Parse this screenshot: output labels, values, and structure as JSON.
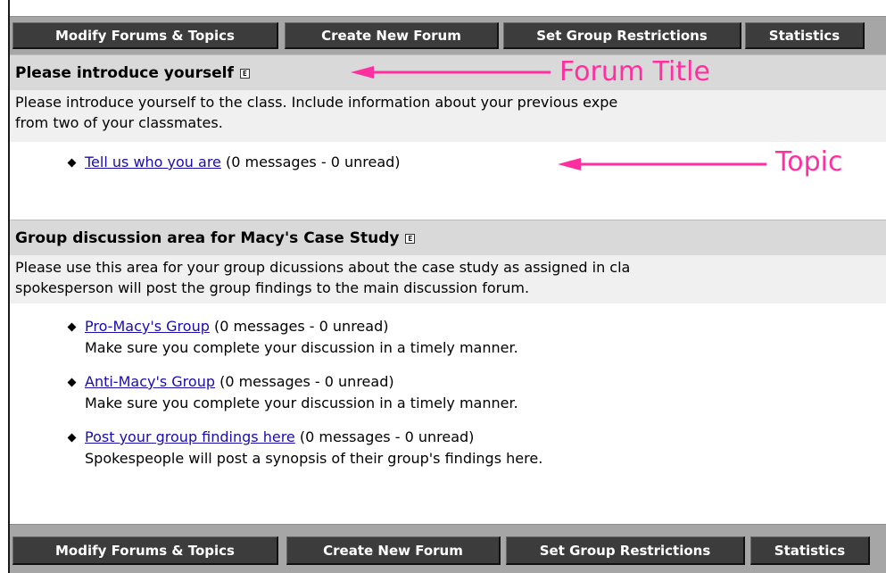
{
  "toolbar": {
    "buttons": [
      {
        "label": "Modify Forums & Topics"
      },
      {
        "label": "Create New Forum"
      },
      {
        "label": "Set Group Restrictions"
      },
      {
        "label": "Statistics"
      }
    ]
  },
  "forums": [
    {
      "title": "Please introduce yourself",
      "edit_icon": "E",
      "description_lines": [
        "Please introduce yourself to the class.  Include information about your previous  expe",
        "from two of your classmates."
      ],
      "topics": [
        {
          "link": "Tell us who you are",
          "count": "(0 messages - 0 unread)",
          "note": ""
        }
      ]
    },
    {
      "title": "Group discussion area for Macy's Case Study",
      "edit_icon": "E",
      "description_lines": [
        "Please use this area for your group dicussions about the case study as assigned in cla",
        "spokesperson will post the group findings to the main discussion forum."
      ],
      "topics": [
        {
          "link": "Pro-Macy's Group",
          "count": "(0 messages - 0 unread)",
          "note": "Make sure you complete your discussion in a timely manner."
        },
        {
          "link": "Anti-Macy's Group",
          "count": "(0 messages - 0 unread)",
          "note": "Make sure you complete your discussion in a timely manner."
        },
        {
          "link": "Post your group findings here",
          "count": "(0 messages - 0 unread)",
          "note": "Spokespeople will post a synopsis of their group's findings here."
        }
      ]
    }
  ],
  "annotations": {
    "forum_title": "Forum Title",
    "topic": "Topic",
    "color": "#ff2fa0"
  }
}
